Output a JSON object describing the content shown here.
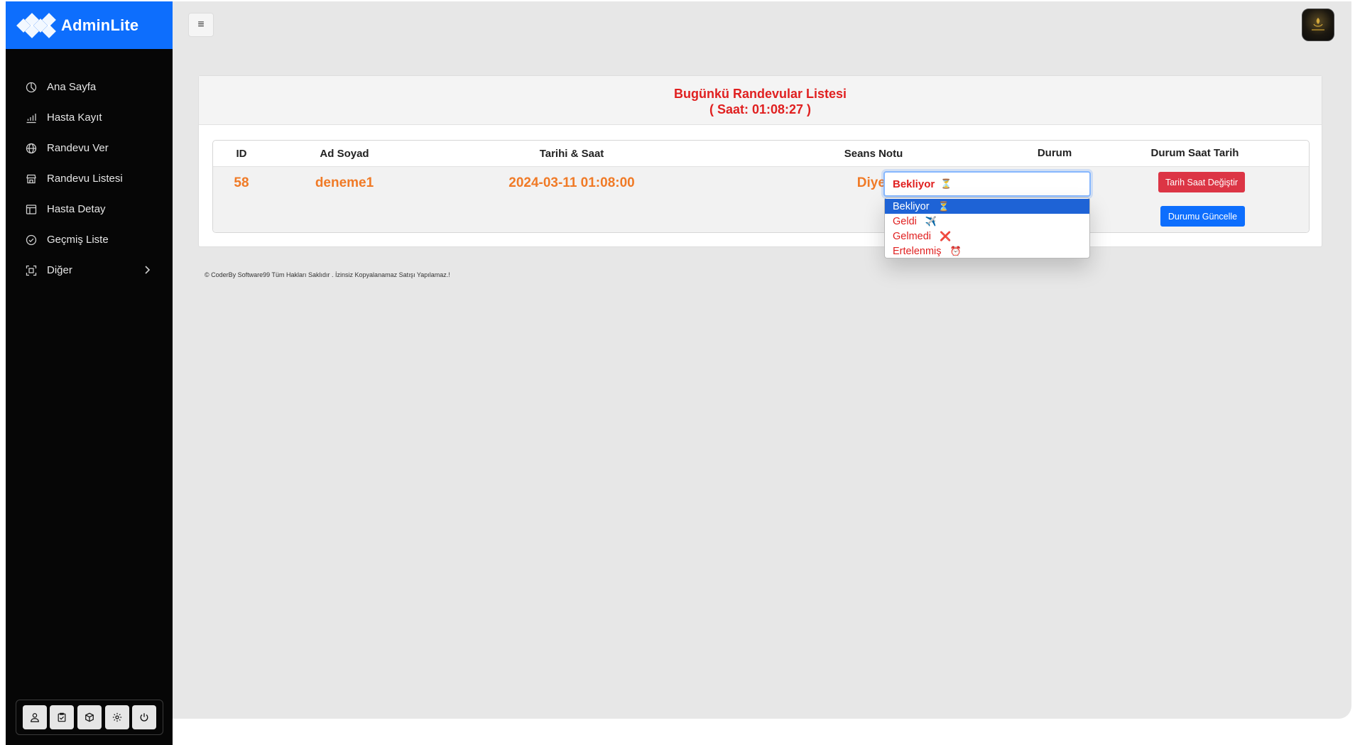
{
  "brand": {
    "name": "AdminLite"
  },
  "sidebar": {
    "items": [
      {
        "label": "Ana Sayfa",
        "icon": "pie-chart-icon"
      },
      {
        "label": "Hasta Kayıt",
        "icon": "bar-chart-icon"
      },
      {
        "label": "Randevu Ver",
        "icon": "globe-icon"
      },
      {
        "label": "Randevu Listesi",
        "icon": "store-icon"
      },
      {
        "label": "Hasta Detay",
        "icon": "layout-icon"
      },
      {
        "label": "Geçmiş Liste",
        "icon": "check-circle-icon"
      },
      {
        "label": "Diğer",
        "icon": "scan-icon",
        "has_submenu": true
      }
    ],
    "bottom_buttons": [
      "user-icon",
      "clipboard-icon",
      "box-icon",
      "gear-icon",
      "power-icon"
    ]
  },
  "header": {
    "menu_glyph": "≡"
  },
  "card": {
    "title": "Bugünkü Randevular Listesi",
    "subtitle": "( Saat: 01:08:27 )"
  },
  "table": {
    "headers": [
      "ID",
      "Ad Soyad",
      "Tarihi & Saat",
      "Seans Notu",
      "Durum",
      "Durum Saat Tarih"
    ],
    "row": {
      "id": "58",
      "name": "deneme1",
      "datetime": "2024-03-11 01:08:00",
      "note": "Diyet",
      "status_selected": "Bekliyor",
      "status_selected_emoji": "⏳"
    },
    "status_options": [
      {
        "label": "Bekliyor",
        "emoji": "⏳"
      },
      {
        "label": "Geldi",
        "emoji": "✈️"
      },
      {
        "label": "Gelmedi",
        "emoji": "❌"
      },
      {
        "label": "Ertelenmiş",
        "emoji": "⏰"
      }
    ],
    "buttons": {
      "change_datetime": "Tarih Saat Değiştir",
      "update_status": "Durumu Güncelle"
    }
  },
  "footer": {
    "text": "© CoderBy Software99 Tüm Hakları Saklıdır . İzinsiz Kopyalanamaz Satışı Yapılamaz.!"
  },
  "colors": {
    "primary": "#0d6efd",
    "danger": "#dc3545",
    "title_red": "#e02020",
    "accent_orange": "#f07a26",
    "sidebar_bg": "#060606"
  }
}
